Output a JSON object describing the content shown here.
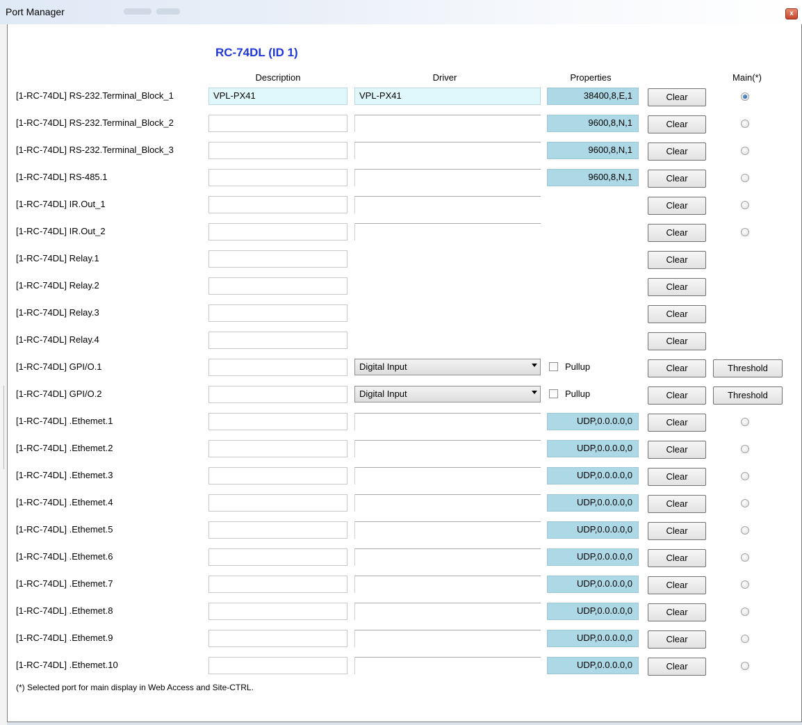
{
  "window": {
    "title": "Port Manager",
    "close_glyph": "x"
  },
  "device": {
    "heading": "RC-74DL (ID 1)"
  },
  "columns": {
    "description": "Description",
    "driver": "Driver",
    "properties": "Properties",
    "main": "Main(*)"
  },
  "buttons": {
    "clear": "Clear",
    "threshold": "Threshold"
  },
  "gpio": {
    "mode": "Digital Input",
    "pullup_label": "Pullup"
  },
  "rows": [
    {
      "label": "[1-RC-74DL] RS-232.Terminal_Block_1",
      "description": "VPL-PX41",
      "driver": "VPL-PX41",
      "properties": "38400,8,E,1",
      "main_selected": true
    },
    {
      "label": "[1-RC-74DL] RS-232.Terminal_Block_2",
      "description": "",
      "driver": "",
      "properties": "9600,8,N,1",
      "main_selected": false
    },
    {
      "label": "[1-RC-74DL] RS-232.Terminal_Block_3",
      "description": "",
      "driver": "",
      "properties": "9600,8,N,1",
      "main_selected": false
    },
    {
      "label": "[1-RC-74DL] RS-485.1",
      "description": "",
      "driver": "",
      "properties": "9600,8,N,1",
      "main_selected": false
    },
    {
      "label": "[1-RC-74DL] IR.Out_1",
      "description": "",
      "driver": "",
      "main_selected": false
    },
    {
      "label": "[1-RC-74DL] IR.Out_2",
      "description": "",
      "driver": "",
      "main_selected": false
    },
    {
      "label": "[1-RC-74DL] Relay.1",
      "description": ""
    },
    {
      "label": "[1-RC-74DL] Relay.2",
      "description": ""
    },
    {
      "label": "[1-RC-74DL] Relay.3",
      "description": ""
    },
    {
      "label": "[1-RC-74DL] Relay.4",
      "description": ""
    },
    {
      "label": "[1-RC-74DL] GPI/O.1",
      "description": ""
    },
    {
      "label": "[1-RC-74DL] GPI/O.2",
      "description": ""
    },
    {
      "label": "[1-RC-74DL] .Ethemet.1",
      "description": "",
      "driver": "",
      "properties": "UDP,0.0.0.0,0",
      "main_selected": false
    },
    {
      "label": "[1-RC-74DL] .Ethemet.2",
      "description": "",
      "driver": "",
      "properties": "UDP,0.0.0.0,0",
      "main_selected": false
    },
    {
      "label": "[1-RC-74DL] .Ethemet.3",
      "description": "",
      "driver": "",
      "properties": "UDP,0.0.0.0,0",
      "main_selected": false
    },
    {
      "label": "[1-RC-74DL] .Ethemet.4",
      "description": "",
      "driver": "",
      "properties": "UDP,0.0.0.0,0",
      "main_selected": false
    },
    {
      "label": "[1-RC-74DL] .Ethemet.5",
      "description": "",
      "driver": "",
      "properties": "UDP,0.0.0.0,0",
      "main_selected": false
    },
    {
      "label": "[1-RC-74DL] .Ethemet.6",
      "description": "",
      "driver": "",
      "properties": "UDP,0.0.0.0,0",
      "main_selected": false
    },
    {
      "label": "[1-RC-74DL] .Ethemet.7",
      "description": "",
      "driver": "",
      "properties": "UDP,0.0.0.0,0",
      "main_selected": false
    },
    {
      "label": "[1-RC-74DL] .Ethemet.8",
      "description": "",
      "driver": "",
      "properties": "UDP,0.0.0.0,0",
      "main_selected": false
    },
    {
      "label": "[1-RC-74DL] .Ethemet.9",
      "description": "",
      "driver": "",
      "properties": "UDP,0.0.0.0,0",
      "main_selected": false
    },
    {
      "label": "[1-RC-74DL] .Ethemet.10",
      "description": "",
      "driver": "",
      "properties": "UDP,0.0.0.0,0",
      "main_selected": false
    }
  ],
  "footnote": "(*) Selected port for main display in Web Access and Site-CTRL."
}
